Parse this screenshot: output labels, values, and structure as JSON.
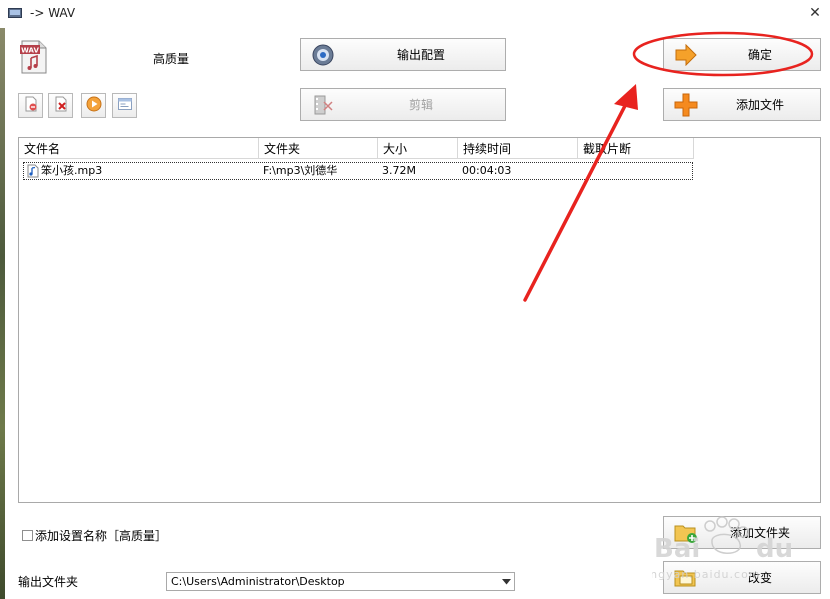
{
  "window": {
    "title": "-> WAV"
  },
  "profile": {
    "quality_label": "高质量"
  },
  "buttons": {
    "output_config": "输出配置",
    "cut": "剪辑",
    "ok": "确定",
    "add_file": "添加文件",
    "add_folder": "添加文件夹",
    "change": "改变"
  },
  "file_list": {
    "columns": [
      "文件名",
      "文件夹",
      "大小",
      "持续时间",
      "截取片断"
    ],
    "rows": [
      {
        "name": "笨小孩.mp3",
        "folder": "F:\\mp3\\刘德华",
        "size": "3.72M",
        "duration": "00:04:03",
        "clip": ""
      }
    ]
  },
  "bottom": {
    "add_setting_label": "添加设置名称［高质量］",
    "output_folder_label": "输出文件夹",
    "output_path": "C:\\Users\\Administrator\\Desktop"
  },
  "colors": {
    "annotation_red": "#e8231f",
    "button_border": "#adadad"
  }
}
